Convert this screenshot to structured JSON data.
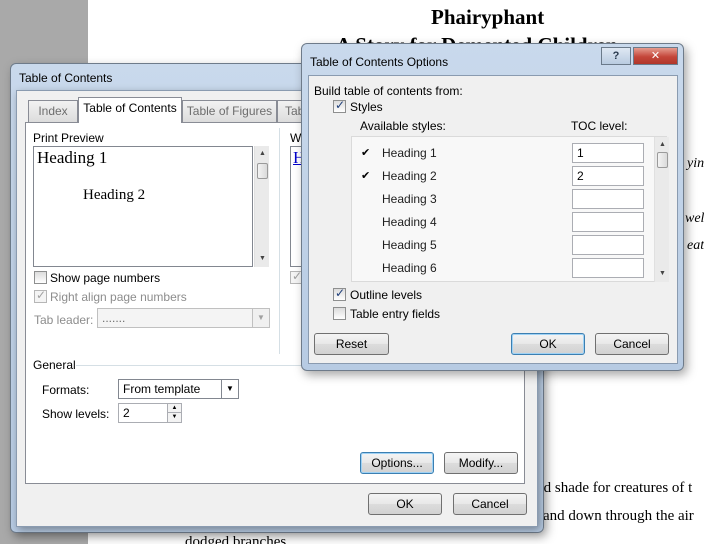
{
  "document": {
    "title_line1": "Phairyphant",
    "title_line2": "A Story for Demented Children",
    "fragment1": "ying",
    "fragment2": "well-",
    "fragment3": "eat",
    "line1": "ed shade for creatures of t",
    "line2": "and down through the air",
    "line3": "dodged branches"
  },
  "toc_dialog": {
    "title": "Table of Contents",
    "tabs": [
      "Index",
      "Table of Contents",
      "Table of Figures",
      "Tab"
    ],
    "print_preview_label": "Print Preview",
    "web_preview_label": "We",
    "preview_heading1": "Heading 1",
    "preview_heading2": "Heading 2",
    "web_preview_text": "H",
    "show_page_numbers": {
      "label": "Show page numbers",
      "checked": false
    },
    "right_align": {
      "label": "Right align page numbers",
      "checked": true
    },
    "tab_leader_label": "Tab leader:",
    "tab_leader_value": ".......",
    "general_label": "General",
    "formats_label": "Formats:",
    "formats_value": "From template",
    "show_levels_label": "Show levels:",
    "show_levels_value": "2",
    "options_button": "Options...",
    "modify_button": "Modify...",
    "ok_button": "OK",
    "cancel_button": "Cancel"
  },
  "options_dialog": {
    "title": "Table of Contents Options",
    "help_button": "?",
    "close_button": "✕",
    "build_label": "Build table of contents from:",
    "styles_label": "Styles",
    "available_styles_label": "Available styles:",
    "toc_level_label": "TOC level:",
    "rows": [
      {
        "check": "✔",
        "name": "Heading 1",
        "level": "1"
      },
      {
        "check": "✔",
        "name": "Heading 2",
        "level": "2"
      },
      {
        "check": "",
        "name": "Heading 3",
        "level": ""
      },
      {
        "check": "",
        "name": "Heading 4",
        "level": ""
      },
      {
        "check": "",
        "name": "Heading 5",
        "level": ""
      },
      {
        "check": "",
        "name": "Heading 6",
        "level": ""
      }
    ],
    "outline_levels": {
      "label": "Outline levels",
      "checked": true
    },
    "table_entry_fields": {
      "label": "Table entry fields",
      "checked": false
    },
    "reset_button": "Reset",
    "ok_button": "OK",
    "cancel_button": "Cancel"
  },
  "colors": {
    "frame_blue": "#b7cbe3",
    "close_red": "#c4463a",
    "hyperlink": "#0000cc"
  }
}
